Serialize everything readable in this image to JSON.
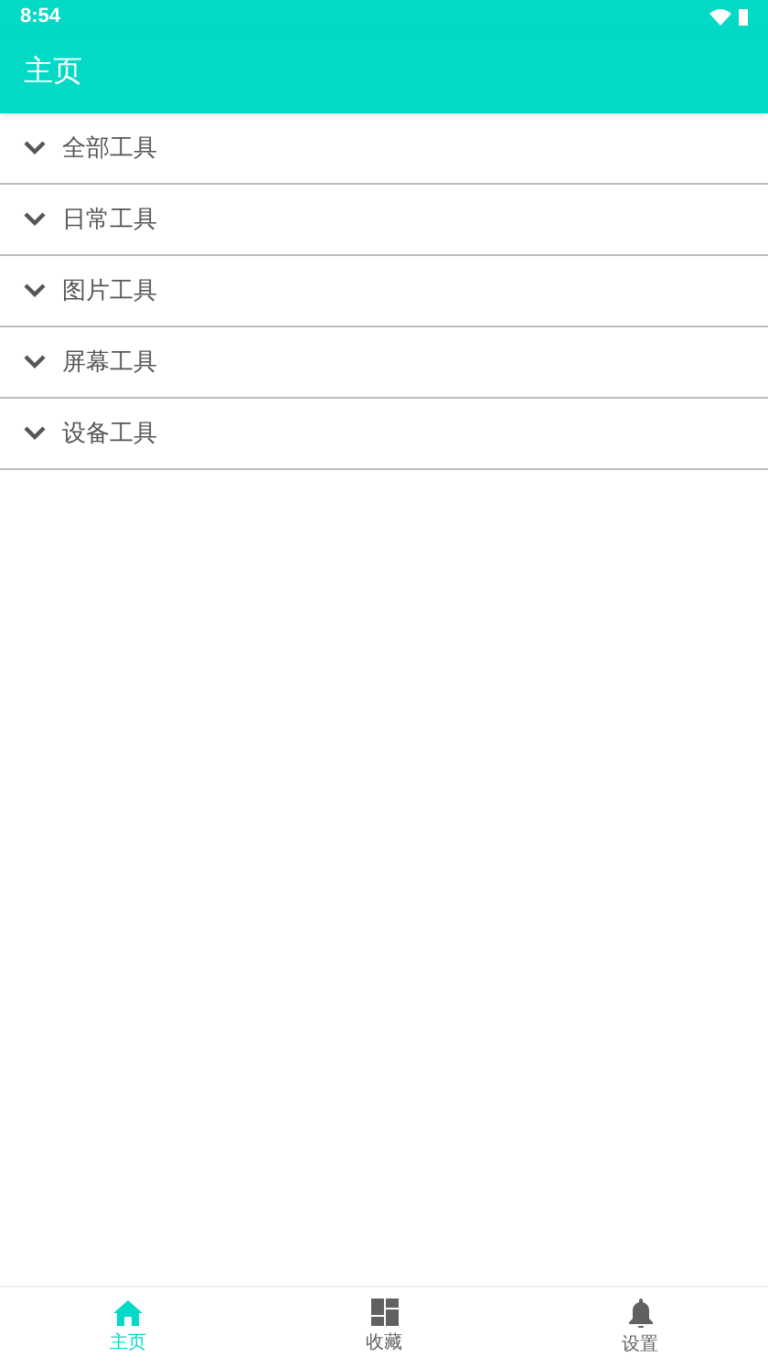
{
  "status_bar": {
    "time": "8:54"
  },
  "app_bar": {
    "title": "主页"
  },
  "sections": [
    {
      "label": "全部工具"
    },
    {
      "label": "日常工具"
    },
    {
      "label": "图片工具"
    },
    {
      "label": "屏幕工具"
    },
    {
      "label": "设备工具"
    }
  ],
  "bottom_nav": [
    {
      "kind": "home",
      "label": "主页",
      "selected": true
    },
    {
      "kind": "grid",
      "label": "收藏",
      "selected": false
    },
    {
      "kind": "bell",
      "label": "设置",
      "selected": false
    }
  ]
}
